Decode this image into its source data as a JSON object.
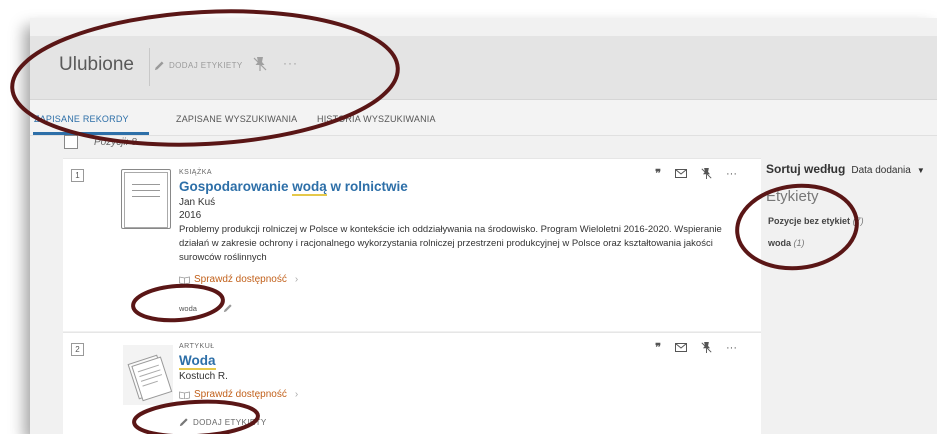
{
  "header": {
    "title": "Ulubione",
    "add_tags_label": "DODAJ ETYKIETY",
    "more_label": "···"
  },
  "tabs": [
    {
      "label": "ZAPISANE REKORDY",
      "active": true
    },
    {
      "label": "ZAPISANE WYSZUKIWANIA",
      "active": false
    },
    {
      "label": "HISTORIA WYSZUKIWANIA",
      "active": false
    }
  ],
  "selection": {
    "count_text": "Pozycji: 8"
  },
  "records": [
    {
      "index": "1",
      "type": "KSIĄŻKA",
      "title_before": "Gospodarowanie ",
      "title_highlight": "wodą",
      "title_after": " w rolnictwie",
      "author": "Jan Kuś",
      "year": "2016",
      "description": "Problemy produkcji rolniczej w Polsce w kontekście ich oddziaływania na środowisko. Program Wieloletni 2016-2020. Wspieranie działań w zakresie ochrony i racjonalnego wykorzystania rolniczej przestrzeni produkcyjnej w Polsce oraz kształtowania jakości surowców roślinnych",
      "availability": "Sprawdź dostępność",
      "tag": "woda",
      "icon": "book-icon"
    },
    {
      "index": "2",
      "type": "ARTYKUŁ",
      "title_highlight": "Woda",
      "author": "Kostuch R.",
      "availability": "Sprawdź dostępność",
      "add_tags_label": "DODAJ ETYKIETY",
      "icon": "document-icon"
    }
  ],
  "record_actions": {
    "quote": "❞",
    "more": "···",
    "icons": [
      "quote-icon",
      "email-icon",
      "unpin-icon",
      "more-icon"
    ]
  },
  "sidebar": {
    "sort_label": "Sortuj według",
    "sort_value": "Data dodania",
    "tags_title": "Etykiety",
    "tags": [
      {
        "name": "Pozycje bez etykiet",
        "count": "(7)",
        "bold": true
      },
      {
        "name": "woda",
        "count": "(1)",
        "bold": true
      }
    ]
  },
  "colors": {
    "accent": "#2d6fa8",
    "availability": "#c2611b",
    "annotation": "#5a1616",
    "highlight": "#e5c84a"
  }
}
